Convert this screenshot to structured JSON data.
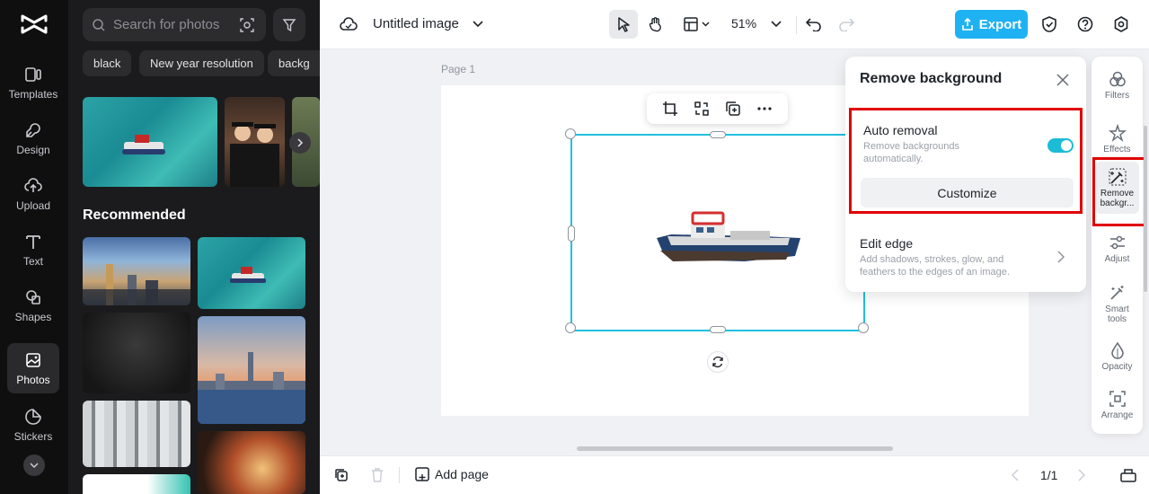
{
  "app": {
    "name": "CapCut"
  },
  "rail": {
    "items": [
      {
        "label": "Templates",
        "icon": "templates-icon"
      },
      {
        "label": "Design",
        "icon": "design-icon"
      },
      {
        "label": "Upload",
        "icon": "upload-icon"
      },
      {
        "label": "Text",
        "icon": "text-icon"
      },
      {
        "label": "Shapes",
        "icon": "shapes-icon"
      },
      {
        "label": "Photos",
        "icon": "photos-icon",
        "active": true
      },
      {
        "label": "Stickers",
        "icon": "stickers-icon"
      }
    ]
  },
  "panel": {
    "search_placeholder": "Search for photos",
    "chips": [
      "black",
      "New year resolution",
      "backg"
    ],
    "recommended_title": "Recommended"
  },
  "topbar": {
    "doc_title": "Untitled image",
    "zoom": "51%",
    "export_label": "Export"
  },
  "canvas": {
    "page_label": "Page 1"
  },
  "popup": {
    "title": "Remove background",
    "auto_removal": {
      "title": "Auto removal",
      "description": "Remove backgrounds automatically.",
      "enabled": true,
      "customize_label": "Customize"
    },
    "edit_edge": {
      "title": "Edit edge",
      "description": "Add shadows, strokes, glow, and feathers to the edges of an image."
    }
  },
  "tools": [
    {
      "label": "Filters",
      "icon": "filters-icon"
    },
    {
      "label": "Effects",
      "icon": "effects-icon"
    },
    {
      "label": "Remove backgr...",
      "icon": "remove-background-icon",
      "active": true
    },
    {
      "label": "Adjust",
      "icon": "adjust-icon"
    },
    {
      "label": "Smart tools",
      "icon": "smart-tools-icon"
    },
    {
      "label": "Opacity",
      "icon": "opacity-icon"
    },
    {
      "label": "Arrange",
      "icon": "arrange-icon"
    }
  ],
  "bottombar": {
    "add_page_label": "Add page",
    "page_count": "1/1"
  },
  "colors": {
    "accent": "#1fb2f3",
    "selection": "#20c0df",
    "highlight": "#e00000",
    "toggle_on": "#1cbcd6"
  }
}
